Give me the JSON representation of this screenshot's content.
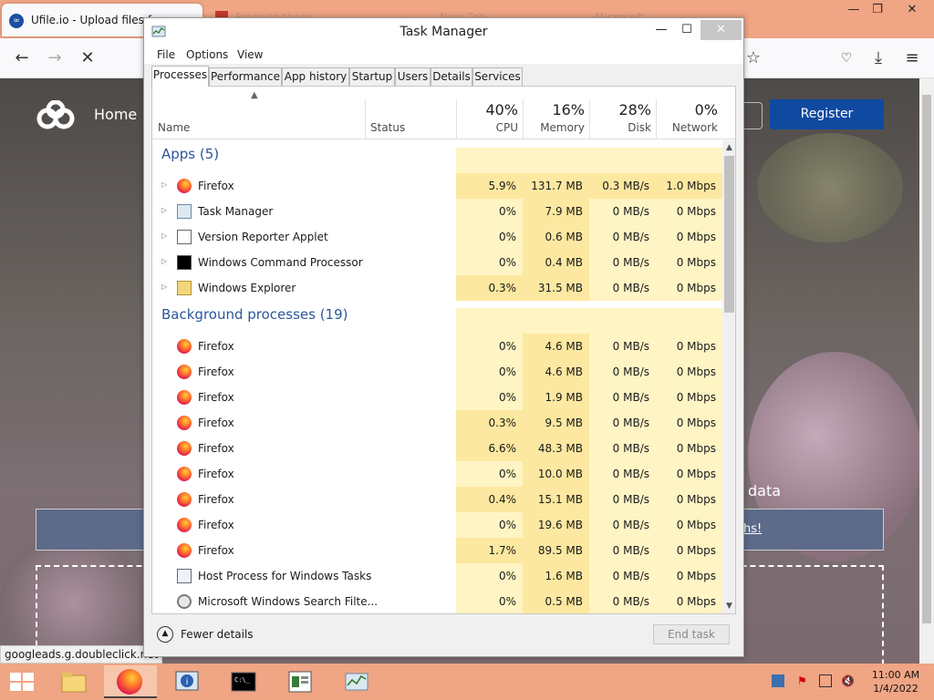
{
  "browser": {
    "tab_title": "Ufile.io - Upload files fo",
    "tab2_title": "Freewebshare",
    "tab3_title": "New Tab",
    "tab4_title": "Microsoft",
    "site": {
      "home": "Home",
      "register": "Register",
      "data_text": "data",
      "banner_link": "hs!"
    },
    "status_url": "googleads.g.doubleclick.net"
  },
  "task_manager": {
    "title": "Task Manager",
    "menu": [
      "File",
      "Options",
      "View"
    ],
    "tabs": [
      "Processes",
      "Performance",
      "App history",
      "Startup",
      "Users",
      "Details",
      "Services"
    ],
    "columns": {
      "name": "Name",
      "status": "Status",
      "cpu": {
        "pct": "40%",
        "label": "CPU"
      },
      "memory": {
        "pct": "16%",
        "label": "Memory"
      },
      "disk": {
        "pct": "28%",
        "label": "Disk"
      },
      "network": {
        "pct": "0%",
        "label": "Network"
      }
    },
    "groups": {
      "apps": "Apps (5)",
      "background": "Background processes (19)"
    },
    "apps": [
      {
        "name": "Firefox",
        "icon": "firefox-icon",
        "cpu": "5.9%",
        "mem": "131.7 MB",
        "disk": "0.3 MB/s",
        "net": "1.0 Mbps"
      },
      {
        "name": "Task Manager",
        "icon": "task-manager-icon",
        "cpu": "0%",
        "mem": "7.9 MB",
        "disk": "0 MB/s",
        "net": "0 Mbps"
      },
      {
        "name": "Version Reporter Applet",
        "icon": "window-icon",
        "cpu": "0%",
        "mem": "0.6 MB",
        "disk": "0 MB/s",
        "net": "0 Mbps"
      },
      {
        "name": "Windows Command Processor",
        "icon": "cmd-icon",
        "cpu": "0%",
        "mem": "0.4 MB",
        "disk": "0 MB/s",
        "net": "0 Mbps"
      },
      {
        "name": "Windows Explorer",
        "icon": "explorer-icon",
        "cpu": "0.3%",
        "mem": "31.5 MB",
        "disk": "0 MB/s",
        "net": "0 Mbps"
      }
    ],
    "background": [
      {
        "name": "Firefox",
        "icon": "firefox-icon",
        "cpu": "0%",
        "mem": "4.6 MB",
        "disk": "0 MB/s",
        "net": "0 Mbps"
      },
      {
        "name": "Firefox",
        "icon": "firefox-icon",
        "cpu": "0%",
        "mem": "4.6 MB",
        "disk": "0 MB/s",
        "net": "0 Mbps"
      },
      {
        "name": "Firefox",
        "icon": "firefox-icon",
        "cpu": "0%",
        "mem": "1.9 MB",
        "disk": "0 MB/s",
        "net": "0 Mbps"
      },
      {
        "name": "Firefox",
        "icon": "firefox-icon",
        "cpu": "0.3%",
        "mem": "9.5 MB",
        "disk": "0 MB/s",
        "net": "0 Mbps"
      },
      {
        "name": "Firefox",
        "icon": "firefox-icon",
        "cpu": "6.6%",
        "mem": "48.3 MB",
        "disk": "0 MB/s",
        "net": "0 Mbps"
      },
      {
        "name": "Firefox",
        "icon": "firefox-icon",
        "cpu": "0%",
        "mem": "10.0 MB",
        "disk": "0 MB/s",
        "net": "0 Mbps"
      },
      {
        "name": "Firefox",
        "icon": "firefox-icon",
        "cpu": "0.4%",
        "mem": "15.1 MB",
        "disk": "0 MB/s",
        "net": "0 Mbps"
      },
      {
        "name": "Firefox",
        "icon": "firefox-icon",
        "cpu": "0%",
        "mem": "19.6 MB",
        "disk": "0 MB/s",
        "net": "0 Mbps"
      },
      {
        "name": "Firefox",
        "icon": "firefox-icon",
        "cpu": "1.7%",
        "mem": "89.5 MB",
        "disk": "0 MB/s",
        "net": "0 Mbps"
      },
      {
        "name": "Host Process for Windows Tasks",
        "icon": "host-process-icon",
        "cpu": "0%",
        "mem": "1.6 MB",
        "disk": "0 MB/s",
        "net": "0 Mbps"
      },
      {
        "name": "Microsoft Windows Search Filte...",
        "icon": "search-filter-icon",
        "cpu": "0%",
        "mem": "0.5 MB",
        "disk": "0 MB/s",
        "net": "0 Mbps"
      }
    ],
    "fewer_details": "Fewer details",
    "end_task": "End task"
  },
  "taskbar": {
    "time": "11:00 AM",
    "date": "1/4/2022"
  },
  "colors": {
    "accent_orange": "#f0a584",
    "group_blue": "#2b579a",
    "heat_light": "#fff4c4",
    "heat_medium": "#fce8a0"
  }
}
